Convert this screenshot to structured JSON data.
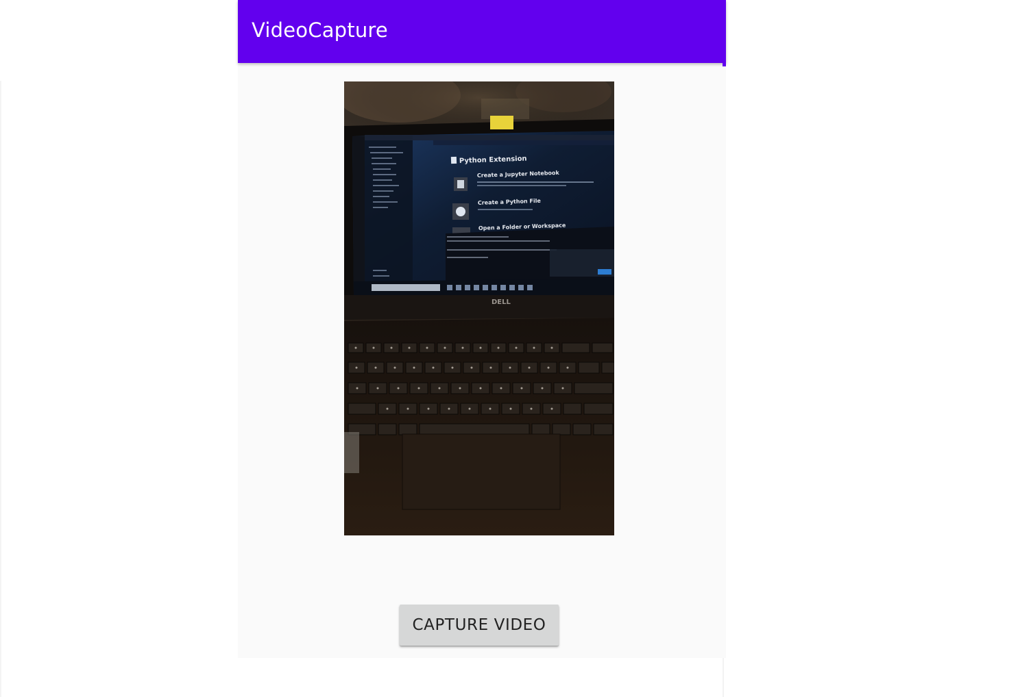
{
  "app": {
    "title": "VideoCapture",
    "accent_color": "#6200ee"
  },
  "preview": {
    "screen_heading": "Python Extension",
    "items": [
      {
        "title": "Create a Jupyter Notebook"
      },
      {
        "title": "Create a Python File"
      },
      {
        "title": "Open a Folder or Workspace"
      }
    ],
    "laptop_brand": "DELL"
  },
  "actions": {
    "capture_label": "CAPTURE VIDEO"
  }
}
